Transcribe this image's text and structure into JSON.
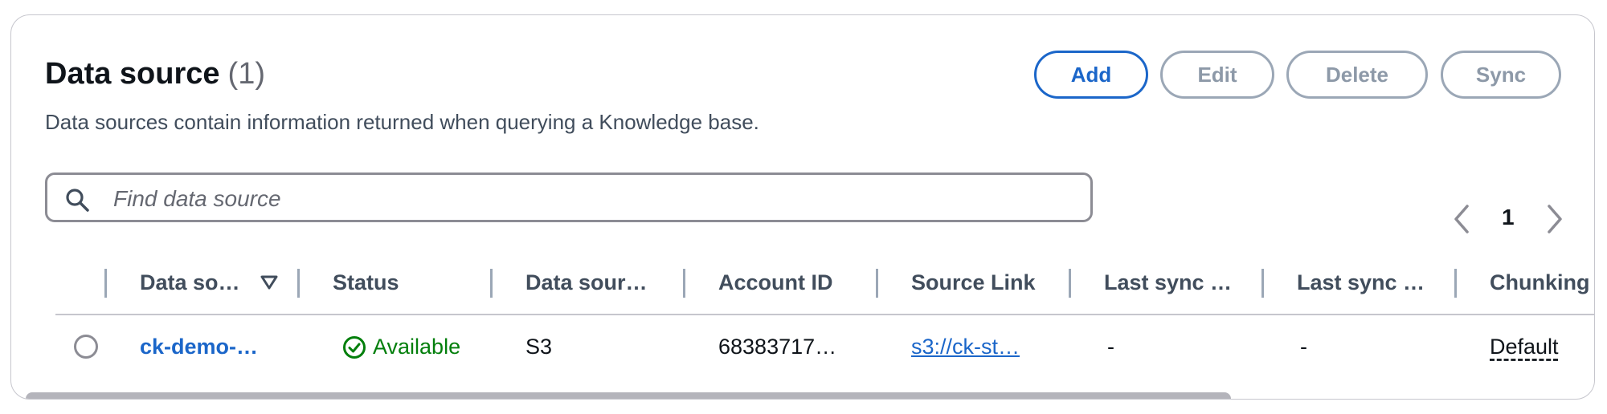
{
  "header": {
    "title": "Data source",
    "count": "(1)",
    "description": "Data sources contain information returned when querying a Knowledge base."
  },
  "actions": {
    "add": "Add",
    "edit": "Edit",
    "delete": "Delete",
    "sync": "Sync"
  },
  "search": {
    "placeholder": "Find data source",
    "value": ""
  },
  "pagination": {
    "current_page": "1"
  },
  "table": {
    "columns": [
      "Data so…",
      "Status",
      "Data sour…",
      "Account ID",
      "Source Link",
      "Last sync …",
      "Last sync …",
      "Chunking"
    ],
    "rows": [
      {
        "name": "ck-demo-…",
        "status": "Available",
        "type": "S3",
        "account_id": "68383717…",
        "source_link": "s3://ck-st…",
        "last_sync_1": "-",
        "last_sync_2": "-",
        "chunking": "Default"
      }
    ]
  },
  "colors": {
    "primary": "#1b66c9",
    "success": "#037f0c",
    "disabled": "#8d99a8"
  },
  "icons": [
    "search-icon",
    "chevron-left-icon",
    "chevron-right-icon",
    "sort-descending-icon",
    "status-available-icon"
  ]
}
